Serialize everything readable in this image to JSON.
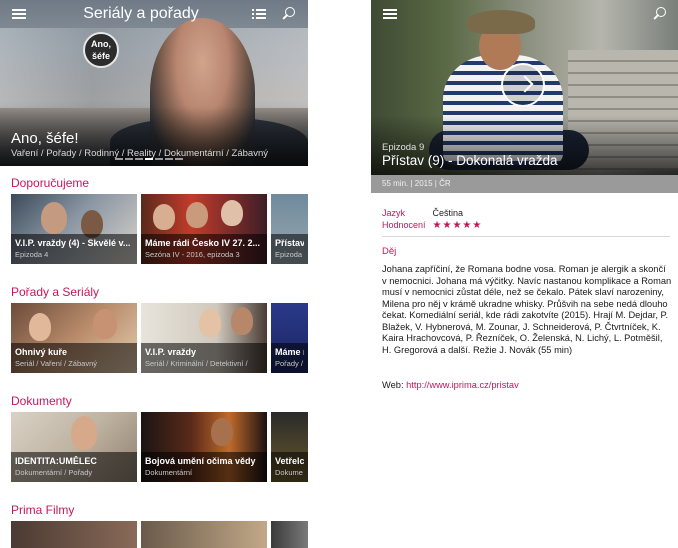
{
  "left": {
    "header": {
      "title": "Seriály a pořady"
    },
    "hero": {
      "logo_text": "Ano, šéfe",
      "title": "Ano, šéfe!",
      "tags": "Vaření / Pořady / Rodinný / Reality / Dokumentární / Zábavný",
      "dots": 7,
      "active_dot": 3
    },
    "sections": [
      {
        "title": "Doporučujeme",
        "tiles": [
          {
            "title": "V.I.P. vraždy (4) - Skvělé v...",
            "subtitle": "Epizoda 4"
          },
          {
            "title": "Máme rádi Česko IV 27. 2...",
            "subtitle": "Sezóna IV - 2016, epizoda 3"
          },
          {
            "title": "Přístav (",
            "subtitle": "Epizoda"
          }
        ]
      },
      {
        "title": "Pořady a Seriály",
        "tiles": [
          {
            "title": "Ohnivý kuře",
            "subtitle": "Seriál / Vaření / Zábavný"
          },
          {
            "title": "V.I.P. vraždy",
            "subtitle": "Seriál / Kriminální / Detektivní /"
          },
          {
            "title": "Máme r",
            "subtitle": "Pořady /"
          }
        ]
      },
      {
        "title": "Dokumenty",
        "tiles": [
          {
            "title": "IDENTITA:UMĚLEC",
            "subtitle": "Dokumentární / Pořady"
          },
          {
            "title": "Bojová umění očima vědy",
            "subtitle": "Dokumentární"
          },
          {
            "title": "Vetřelci",
            "subtitle": "Dokume"
          }
        ]
      },
      {
        "title": "Prima Filmy",
        "tiles": []
      }
    ]
  },
  "right": {
    "episode_label": "Epizoda 9",
    "title": "Přístav (9) - Dokonalá vražda",
    "meta": "55 min. | 2015 | ČR",
    "language_label": "Jazyk",
    "language_value": "Čeština",
    "rating_label": "Hodnocení",
    "rating": 4.5,
    "rating_stars": "★★★★★",
    "plot_label": "Děj",
    "plot": "Johana zapříčiní, že Romana bodne vosa. Roman je alergik a skončí v nemocnici. Johana má výčitky. Navíc nastanou komplikace a Roman musí v nemocnici zůstat déle, než se čekalo. Pátek slaví narozeniny, Milena pro něj v krámě ukradne whisky. Průšvih na sebe nedá dlouho čekat. Komediální seriál, kde rádi zakotvíte (2015). Hrají M. Dejdar, P. Blažek, V. Hybnerová, M. Zounar, J. Schneiderová, P. Čtvrtníček, K. Kaira Hrachovcová, P. Řezníček, O. Želenská, N. Lichý, L. Potměšil, H. Gregorová a další. Režie J. Novák (55 min)",
    "web_label": "Web:",
    "web_url": "http://www.iprima.cz/pristav"
  },
  "colors": {
    "accent": "#c2185b",
    "metabar": "#9a9a9a"
  },
  "icons": [
    "hamburger-icon",
    "list-icon",
    "search-icon",
    "play-icon",
    "star-icon"
  ]
}
